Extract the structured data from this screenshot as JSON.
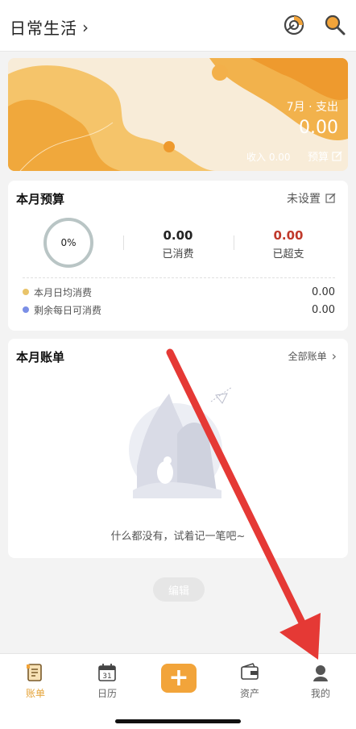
{
  "header": {
    "title": "日常生活",
    "chevron": "›",
    "icons": [
      "chart-icon",
      "search-icon"
    ]
  },
  "banner": {
    "month_label": "7月 · 支出",
    "expense": "0.00",
    "income": "收入 0.00",
    "budget_label": "预算"
  },
  "budget_card": {
    "title": "本月预算",
    "action": "未设置",
    "percent": "0%",
    "spent_value": "0.00",
    "spent_label": "已消费",
    "over_value": "0.00",
    "over_label": "已超支",
    "rows": [
      {
        "label": "本月日均消费",
        "value": "0.00",
        "color": "#e9c46a"
      },
      {
        "label": "剩余每日可消费",
        "value": "0.00",
        "color": "#7b8fe6"
      }
    ]
  },
  "bills_card": {
    "title": "本月账单",
    "action": "全部账单",
    "empty_text": "什么都没有，试着记一笔吧~"
  },
  "edit_button": "编辑",
  "nav": {
    "items": [
      {
        "label": "账单",
        "icon": "bill-icon",
        "active": true
      },
      {
        "label": "日历",
        "icon": "calendar-icon",
        "calendar_day": "31"
      },
      {
        "label": "",
        "icon": "plus-icon"
      },
      {
        "label": "资产",
        "icon": "wallet-icon"
      },
      {
        "label": "我的",
        "icon": "user-icon"
      }
    ]
  },
  "colors": {
    "accent": "#f2a43a",
    "over_red": "#c0392b",
    "annotation_arrow": "#e53935"
  }
}
